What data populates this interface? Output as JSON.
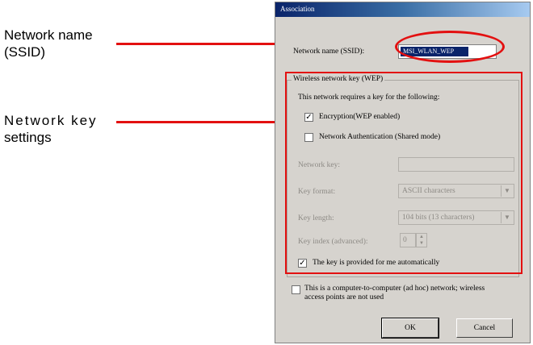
{
  "callouts": {
    "network_name_line1": "Network name",
    "network_name_line2": "(SSID)",
    "network_key_line1": "Network key",
    "network_key_line2": "settings"
  },
  "dialog": {
    "title": "Association",
    "ssid_label": "Network name (SSID):",
    "ssid_value": "MSI_WLAN_WEP",
    "group_title": "Wireless network key (WEP)",
    "group_intro": "This network requires a key for the following:",
    "encryption_label": "Encryption(WEP enabled)",
    "encryption_checked": true,
    "auth_label": "Network Authentication (Shared mode)",
    "auth_checked": false,
    "network_key_label": "Network key:",
    "network_key_value": "",
    "key_format_label": "Key format:",
    "key_format_value": "ASCII characters",
    "key_length_label": "Key length:",
    "key_length_value": "104 bits (13 characters)",
    "key_index_label": "Key index (advanced):",
    "key_index_value": "0",
    "auto_key_label": "The key is provided for me automatically",
    "auto_key_checked": true,
    "adhoc_label_line1": "This is a computer-to-computer (ad hoc) network; wireless",
    "adhoc_label_line2": "access points are not used",
    "adhoc_checked": false,
    "ok_label": "OK",
    "cancel_label": "Cancel"
  },
  "colors": {
    "highlight": "#e31010",
    "dialog_face": "#d6d3ce",
    "title_bar": "#0a246a"
  }
}
